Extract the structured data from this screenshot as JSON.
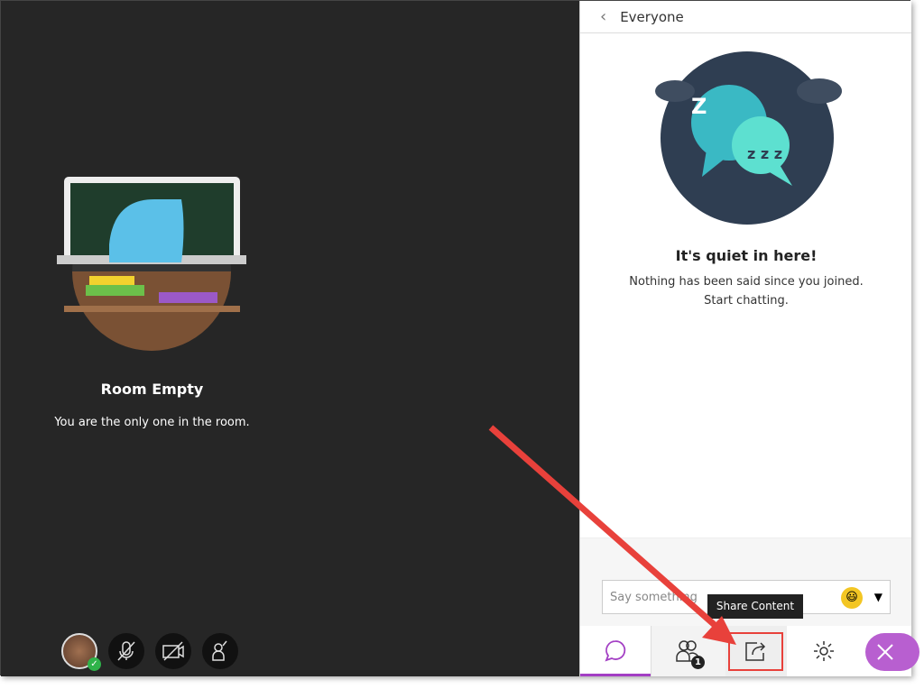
{
  "stage": {
    "title": "Room Empty",
    "message": "You are the only one in the room."
  },
  "panel": {
    "header": "Everyone",
    "empty_title": "It's quiet in here!",
    "empty_line1": "Nothing has been said since you joined.",
    "empty_line2": "Start chatting.",
    "input_placeholder": "Say something",
    "tooltip": "Share Content",
    "attendee_count": "1"
  },
  "colors": {
    "accent": "#a33fc4",
    "close": "#b85fd0",
    "stage_bg": "#262626",
    "arrow": "#e8413b"
  },
  "icons": [
    "back-chevron-icon",
    "emoji-icon",
    "chat-icon",
    "attendees-icon",
    "share-content-icon",
    "settings-icon",
    "close-icon",
    "mic-off-icon",
    "camera-off-icon",
    "raise-hand-icon"
  ]
}
